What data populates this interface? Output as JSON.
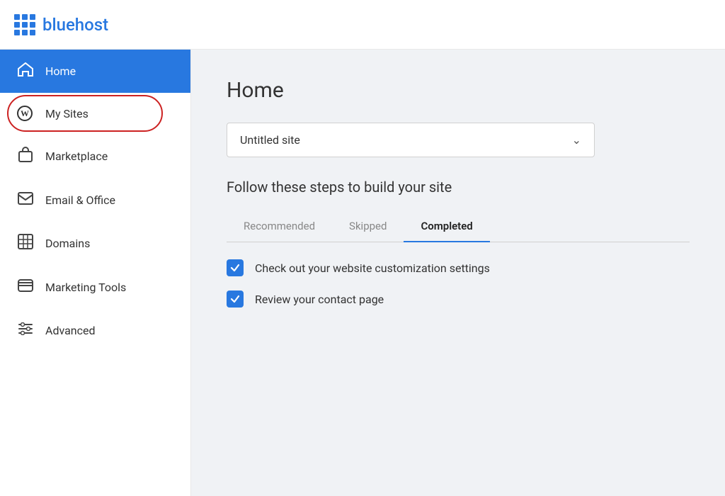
{
  "topbar": {
    "logo_text": "bluehost"
  },
  "sidebar": {
    "items": [
      {
        "id": "home",
        "label": "Home",
        "icon": "home",
        "active": true
      },
      {
        "id": "my-sites",
        "label": "My Sites",
        "icon": "wp",
        "active": false,
        "circled": true
      },
      {
        "id": "marketplace",
        "label": "Marketplace",
        "icon": "bag",
        "active": false
      },
      {
        "id": "email",
        "label": "Email & Office",
        "icon": "mail",
        "active": false
      },
      {
        "id": "domains",
        "label": "Domains",
        "icon": "domain",
        "active": false
      },
      {
        "id": "marketing",
        "label": "Marketing Tools",
        "icon": "marketing",
        "active": false
      },
      {
        "id": "advanced",
        "label": "Advanced",
        "icon": "advanced",
        "active": false
      }
    ]
  },
  "content": {
    "page_title": "Home",
    "site_selector": {
      "current_site": "Untitled site",
      "chevron": "∨"
    },
    "steps_heading": "Follow these steps to build your site",
    "tabs": [
      {
        "id": "recommended",
        "label": "Recommended",
        "active": false
      },
      {
        "id": "skipped",
        "label": "Skipped",
        "active": false
      },
      {
        "id": "completed",
        "label": "Completed",
        "active": true
      }
    ],
    "checklist": [
      {
        "id": "customization",
        "text": "Check out your website customization settings",
        "checked": true
      },
      {
        "id": "contact",
        "text": "Review your contact page",
        "checked": true
      }
    ]
  }
}
